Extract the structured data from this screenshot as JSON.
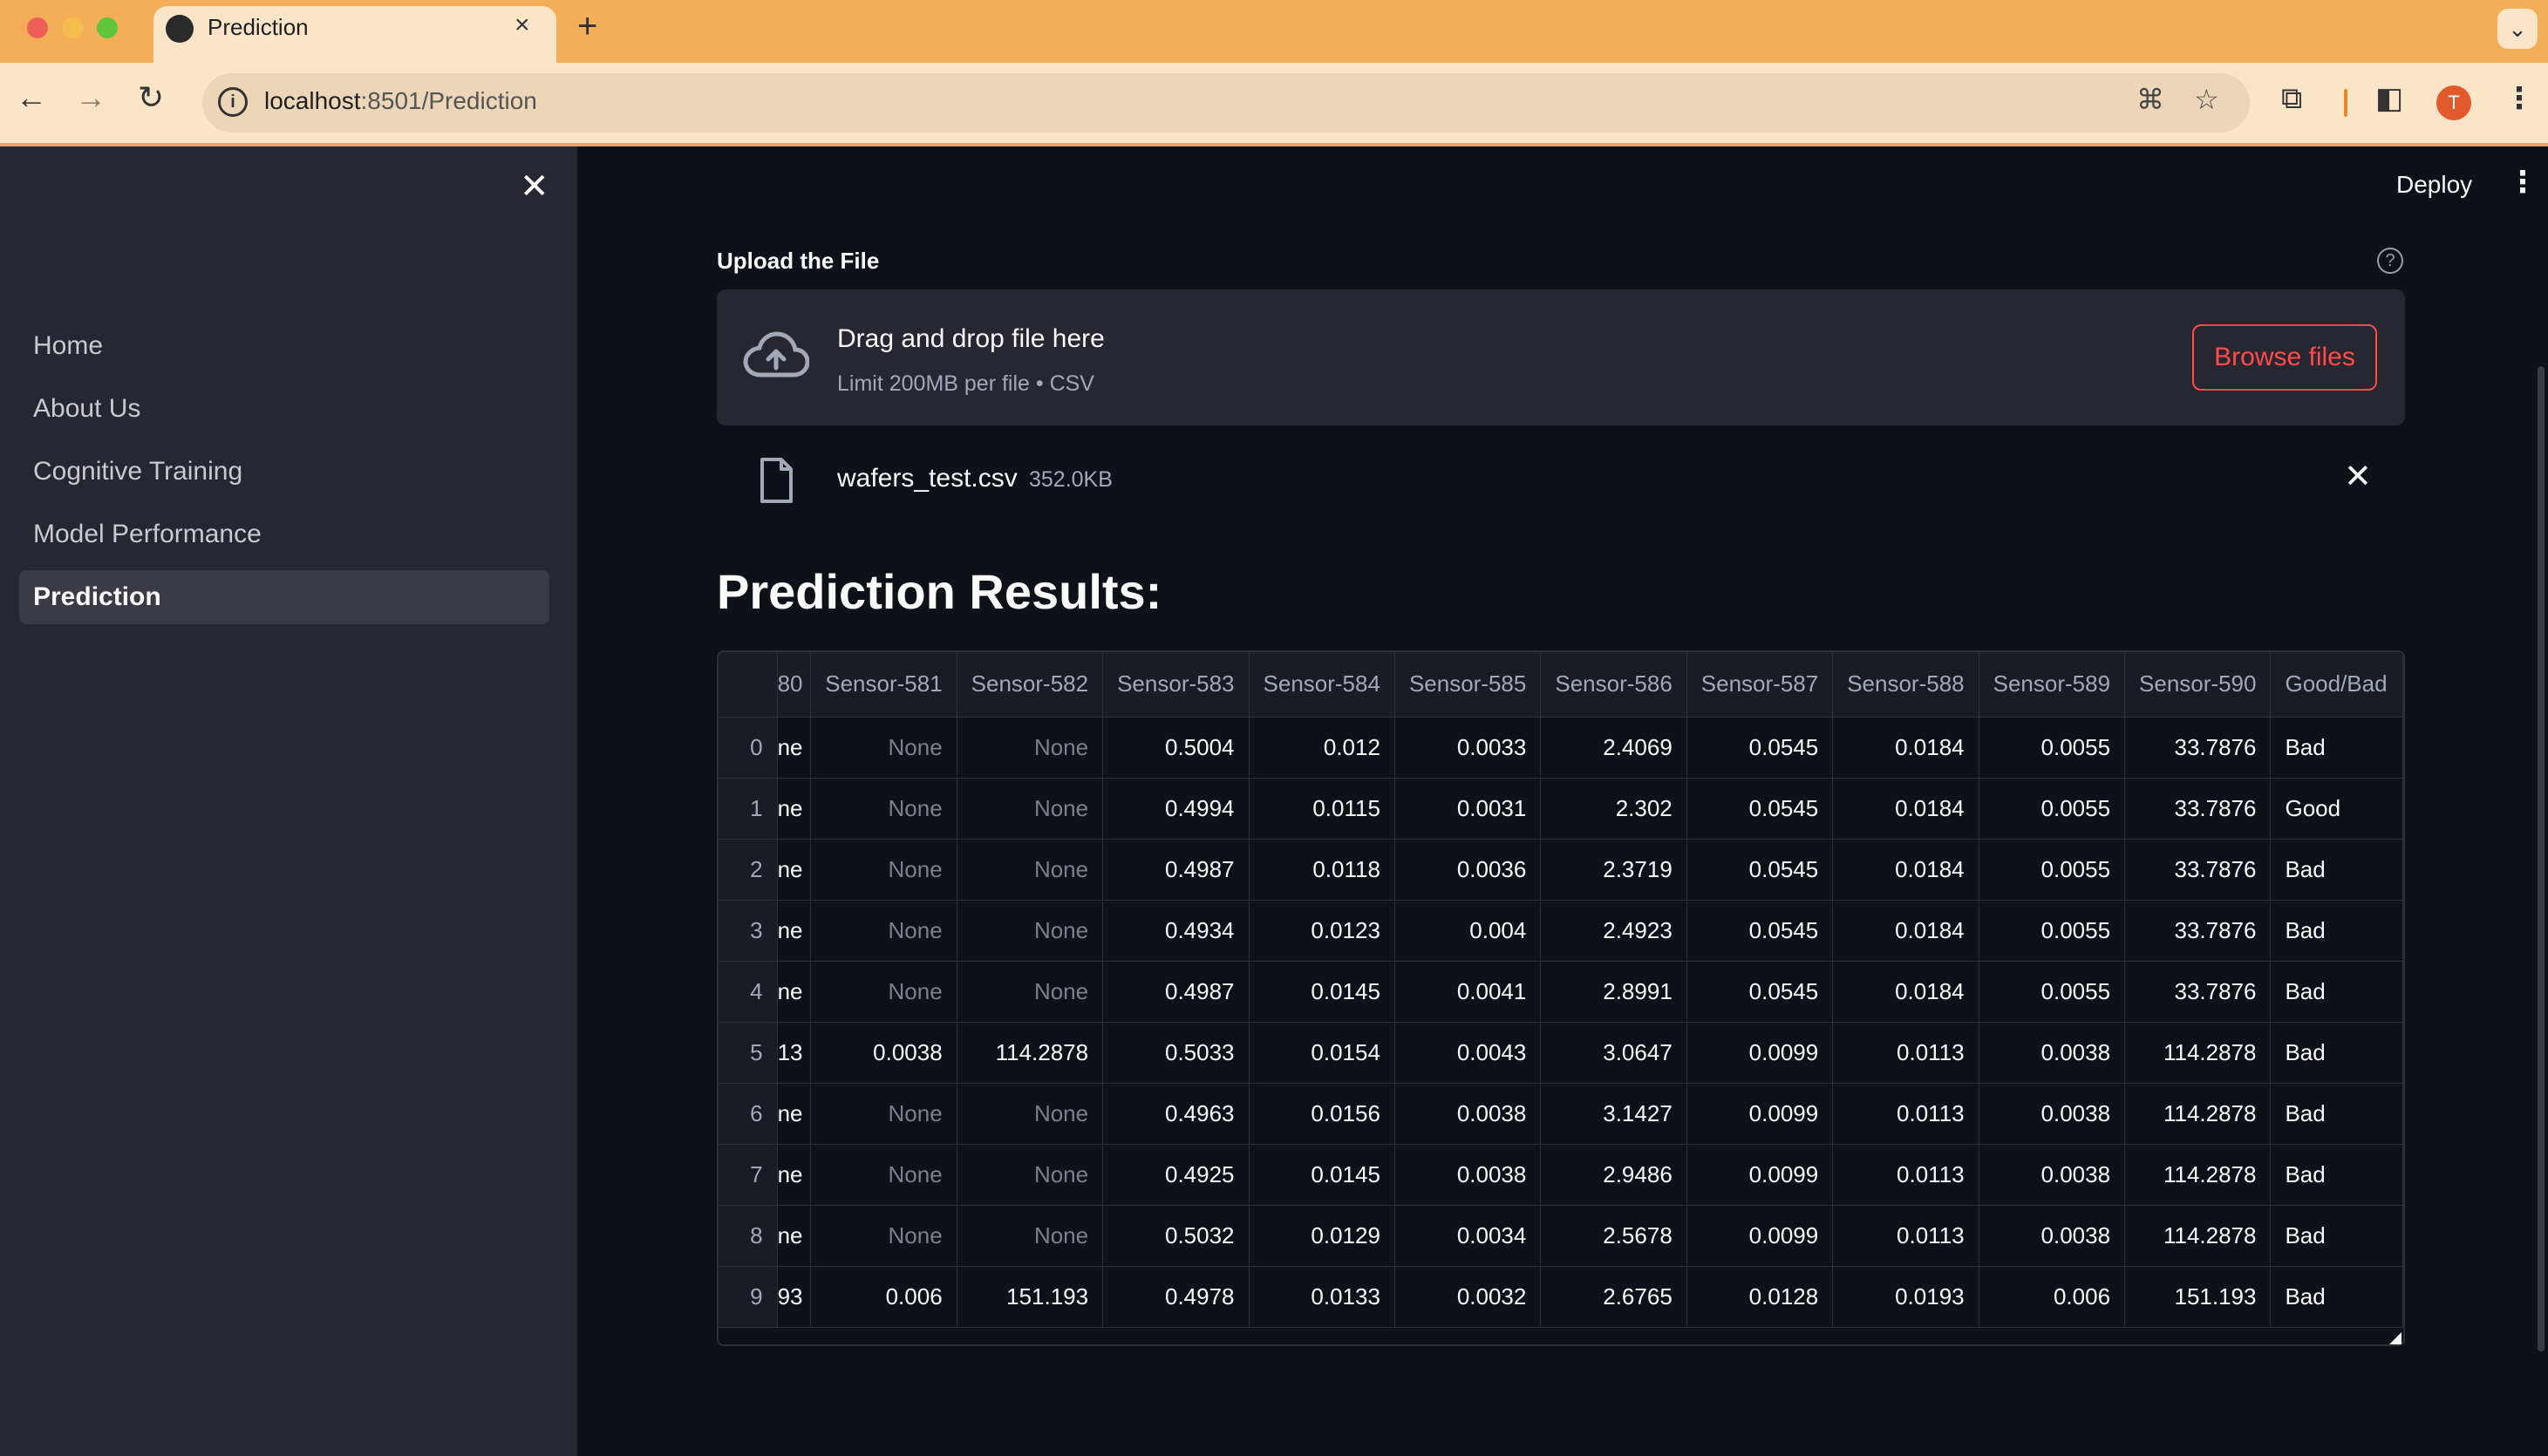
{
  "browser": {
    "tab_title": "Prediction",
    "url_host": "localhost",
    "url_path": ":8501/Prediction",
    "profile_initial": "T"
  },
  "sidebar": {
    "items": [
      {
        "label": "Home",
        "active": false
      },
      {
        "label": "About Us",
        "active": false
      },
      {
        "label": "Cognitive Training",
        "active": false
      },
      {
        "label": "Model Performance",
        "active": false
      },
      {
        "label": "Prediction",
        "active": true
      }
    ]
  },
  "header": {
    "deploy_label": "Deploy"
  },
  "uploader": {
    "label": "Upload the File",
    "drop_title": "Drag and drop file here",
    "drop_sub": "Limit 200MB per file • CSV",
    "browse_label": "Browse files",
    "file_name": "wafers_test.csv",
    "file_size": "352.0KB"
  },
  "results": {
    "title": "Prediction Results:",
    "columns": [
      "80",
      "Sensor-581",
      "Sensor-582",
      "Sensor-583",
      "Sensor-584",
      "Sensor-585",
      "Sensor-586",
      "Sensor-587",
      "Sensor-588",
      "Sensor-589",
      "Sensor-590",
      "Good/Bad"
    ],
    "rows": [
      [
        "0",
        "ne",
        "None",
        "None",
        "0.5004",
        "0.012",
        "0.0033",
        "2.4069",
        "0.0545",
        "0.0184",
        "0.0055",
        "33.7876",
        "Bad"
      ],
      [
        "1",
        "ne",
        "None",
        "None",
        "0.4994",
        "0.0115",
        "0.0031",
        "2.302",
        "0.0545",
        "0.0184",
        "0.0055",
        "33.7876",
        "Good"
      ],
      [
        "2",
        "ne",
        "None",
        "None",
        "0.4987",
        "0.0118",
        "0.0036",
        "2.3719",
        "0.0545",
        "0.0184",
        "0.0055",
        "33.7876",
        "Bad"
      ],
      [
        "3",
        "ne",
        "None",
        "None",
        "0.4934",
        "0.0123",
        "0.004",
        "2.4923",
        "0.0545",
        "0.0184",
        "0.0055",
        "33.7876",
        "Bad"
      ],
      [
        "4",
        "ne",
        "None",
        "None",
        "0.4987",
        "0.0145",
        "0.0041",
        "2.8991",
        "0.0545",
        "0.0184",
        "0.0055",
        "33.7876",
        "Bad"
      ],
      [
        "5",
        "13",
        "0.0038",
        "114.2878",
        "0.5033",
        "0.0154",
        "0.0043",
        "3.0647",
        "0.0099",
        "0.0113",
        "0.0038",
        "114.2878",
        "Bad"
      ],
      [
        "6",
        "ne",
        "None",
        "None",
        "0.4963",
        "0.0156",
        "0.0038",
        "3.1427",
        "0.0099",
        "0.0113",
        "0.0038",
        "114.2878",
        "Bad"
      ],
      [
        "7",
        "ne",
        "None",
        "None",
        "0.4925",
        "0.0145",
        "0.0038",
        "2.9486",
        "0.0099",
        "0.0113",
        "0.0038",
        "114.2878",
        "Bad"
      ],
      [
        "8",
        "ne",
        "None",
        "None",
        "0.5032",
        "0.0129",
        "0.0034",
        "2.5678",
        "0.0099",
        "0.0113",
        "0.0038",
        "114.2878",
        "Bad"
      ],
      [
        "9",
        "93",
        "0.006",
        "151.193",
        "0.4978",
        "0.0133",
        "0.0032",
        "2.6765",
        "0.0128",
        "0.0193",
        "0.006",
        "151.193",
        "Bad"
      ]
    ]
  },
  "icons": {
    "sidebar_close": "close-icon",
    "upload": "cloud-upload-icon",
    "file": "file-icon",
    "remove_file": "close-icon",
    "help": "help-circle-icon",
    "menu": "kebab-menu-icon"
  }
}
